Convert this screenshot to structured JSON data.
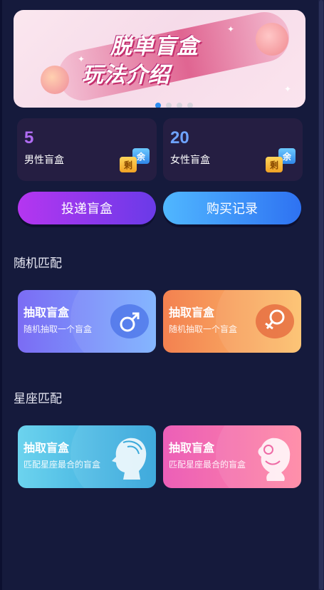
{
  "banner": {
    "title_line1": "脱单盲盒",
    "title_line2": "玩法介绍",
    "page_count": 4,
    "active_page": 1
  },
  "stats": {
    "male": {
      "count": "5",
      "label": "男性盲盒",
      "tag_top": "余",
      "tag_bottom": "剩"
    },
    "female": {
      "count": "20",
      "label": "女性盲盒",
      "tag_top": "余",
      "tag_bottom": "剩"
    }
  },
  "actions": {
    "deliver_label": "投递盲盒",
    "records_label": "购买记录"
  },
  "random_match": {
    "title": "随机匹配",
    "cards": [
      {
        "title": "抽取盲盒",
        "subtitle": "随机抽取一个盲盒",
        "icon": "male-symbol-icon"
      },
      {
        "title": "抽取盲盒",
        "subtitle": "随机抽取一个盲盒",
        "icon": "female-symbol-icon"
      }
    ]
  },
  "zodiac_match": {
    "title": "星座匹配",
    "cards": [
      {
        "title": "抽取盲盒",
        "subtitle": "匹配星座最合的盲盒",
        "icon": "male-profile-icon"
      },
      {
        "title": "抽取盲盒",
        "subtitle": "匹配星座最合的盲盒",
        "icon": "female-profile-icon"
      }
    ]
  },
  "colors": {
    "background": "#151a3c",
    "male_accent": "#b06cf2",
    "female_accent": "#6ea3ff",
    "active_dot": "#2d8df0"
  }
}
